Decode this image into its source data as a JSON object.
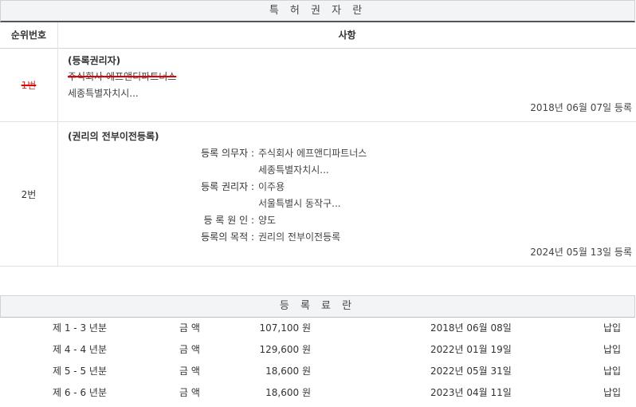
{
  "patent_section": {
    "title": "특 허 권 자 란",
    "col_rank": "순위번호",
    "col_item": "사항",
    "entries": [
      {
        "rank": "1번",
        "heading": "(등록권리자)",
        "lines": [
          "주식회사 에프앤디파트너스",
          "세종특별자치시..."
        ],
        "date_text": "2018년 06월 07일 등록"
      },
      {
        "rank": "2번",
        "heading": "(권리의 전부이전등록)",
        "fields": [
          {
            "label": "등록 의무자 :",
            "value": "주식회사 에프앤디파트너스"
          },
          {
            "label": "",
            "value": "세종특별자치시..."
          },
          {
            "label": "등록 권리자 :",
            "value": "이주용"
          },
          {
            "label": "",
            "value": "서울특별시 동작구..."
          },
          {
            "label": "등 록 원 인 :",
            "value": "양도"
          },
          {
            "label": "등록의 목적 :",
            "value": "권리의 전부이전등록"
          }
        ],
        "date_text": "2024년 05월 13일 등록"
      }
    ]
  },
  "registration_section": {
    "title": "등 록 료 란",
    "rows": [
      {
        "year": "제 1 - 3 년분",
        "amount_label": "금 액",
        "amount": "107,100 원",
        "date": "2018년 06월 08일",
        "status": "납입"
      },
      {
        "year": "제 4 - 4 년분",
        "amount_label": "금 액",
        "amount": "129,600 원",
        "date": "2022년 01월 19일",
        "status": "납입"
      },
      {
        "year": "제 5 - 5 년분",
        "amount_label": "금 액",
        "amount": "18,600 원",
        "date": "2022년 05월 31일",
        "status": "납입"
      },
      {
        "year": "제 6 - 6 년분",
        "amount_label": "금 액",
        "amount": "18,600 원",
        "date": "2023년 04월 11일",
        "status": "납입"
      }
    ]
  },
  "colors": {
    "strike": "#e00000",
    "header_bg": "#f2f4f6",
    "border": "#cfd4d9"
  }
}
